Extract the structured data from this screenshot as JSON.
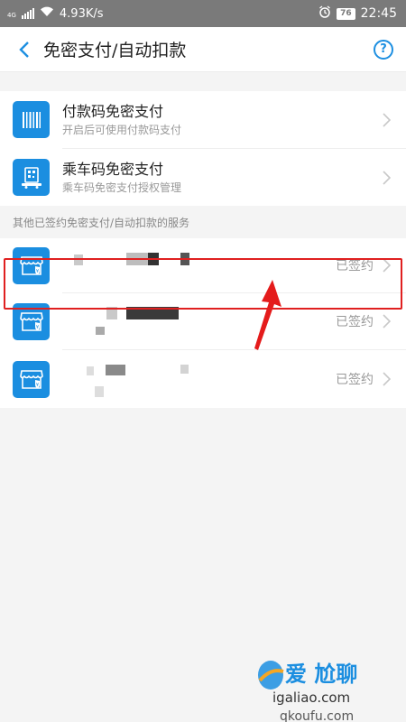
{
  "status_bar": {
    "network_type": "4G",
    "net_speed": "4.93K/s",
    "battery": "76",
    "time": "22:45"
  },
  "nav": {
    "title": "免密支付/自动扣款",
    "help_label": "?"
  },
  "primary": [
    {
      "title": "付款码免密支付",
      "subtitle": "开启后可使用付款码支付",
      "icon": "barcode-icon"
    },
    {
      "title": "乘车码免密支付",
      "subtitle": "乘车码免密支付授权管理",
      "icon": "bus-qr-icon"
    }
  ],
  "section": {
    "label": "其他已签约免密支付/自动扣款的服务"
  },
  "services": [
    {
      "status": "已签约",
      "icon": "store-shield-icon"
    },
    {
      "status": "已签约",
      "icon": "store-shield-icon"
    },
    {
      "status": "已签约",
      "icon": "store-shield-icon"
    }
  ],
  "watermark": {
    "line1": "爱 尬聊",
    "line2": "igaliao.com",
    "line3": "qkoufu.com"
  },
  "colors": {
    "brand": "#1b8ee0",
    "highlight": "#e02020",
    "status_bar": "#7a7a7a"
  }
}
